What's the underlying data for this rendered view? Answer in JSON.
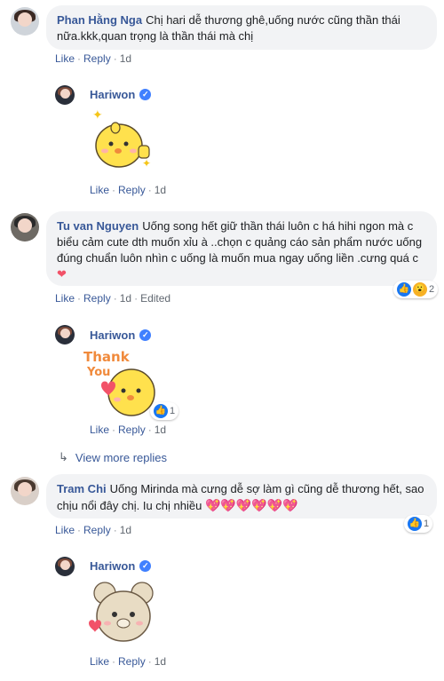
{
  "comments": [
    {
      "author": "Phan Hằng Nga",
      "text": "Chị hari dễ thương ghê,uống nước cũng thần thái nữa.kkk,quan trọng là thần thái mà chị",
      "actions": {
        "like": "Like",
        "reply": "Reply",
        "time": "1d"
      },
      "reply": {
        "author": "Hariwon",
        "sticker": "chick-thumbs-up-sticker",
        "actions": {
          "like": "Like",
          "reply": "Reply",
          "time": "1d"
        }
      }
    },
    {
      "author": "Tu van Nguyen",
      "text": "Uống song hết giữ thần thái luôn c há hihi ngon mà c biểu cảm cute dth muốn xỉu à ..chọn c quảng cáo sản phẩm nước uống đúng chuẩn luôn nhìn c uống là muốn mua ngay uống liền .cưng quá c",
      "actions": {
        "like": "Like",
        "reply": "Reply",
        "time": "1d",
        "edited": "Edited"
      },
      "reaction_count": "2",
      "reply": {
        "author": "Hariwon",
        "sticker": "chick-thank-you-sticker",
        "sticker_text": [
          "Thank",
          "You"
        ],
        "reaction_count": "1",
        "actions": {
          "like": "Like",
          "reply": "Reply",
          "time": "1d"
        }
      },
      "view_more": "View more replies"
    },
    {
      "author": "Tram Chi",
      "text": "Uống Mirinda mà cưng dễ sợ làm gì cũng dễ thương hết, sao chịu nổi đây chị. Iu chị nhiều",
      "hearts": [
        "💖",
        "💖",
        "💖",
        "💖",
        "💖",
        "💖"
      ],
      "actions": {
        "like": "Like",
        "reply": "Reply",
        "time": "1d"
      },
      "reaction_count": "1",
      "reply": {
        "author": "Hariwon",
        "sticker": "bear-heart-sticker",
        "actions": {
          "like": "Like",
          "reply": "Reply",
          "time": "1d"
        }
      }
    }
  ],
  "icons": {
    "verified": "verified-check-icon",
    "like": "like-reaction-icon",
    "wow": "wow-reaction-icon",
    "reply_arrow": "reply-arrow-icon"
  },
  "colors": {
    "link": "#385898",
    "bubble": "#f2f3f5",
    "like_blue": "#1877f2",
    "heart": "#f25268"
  }
}
